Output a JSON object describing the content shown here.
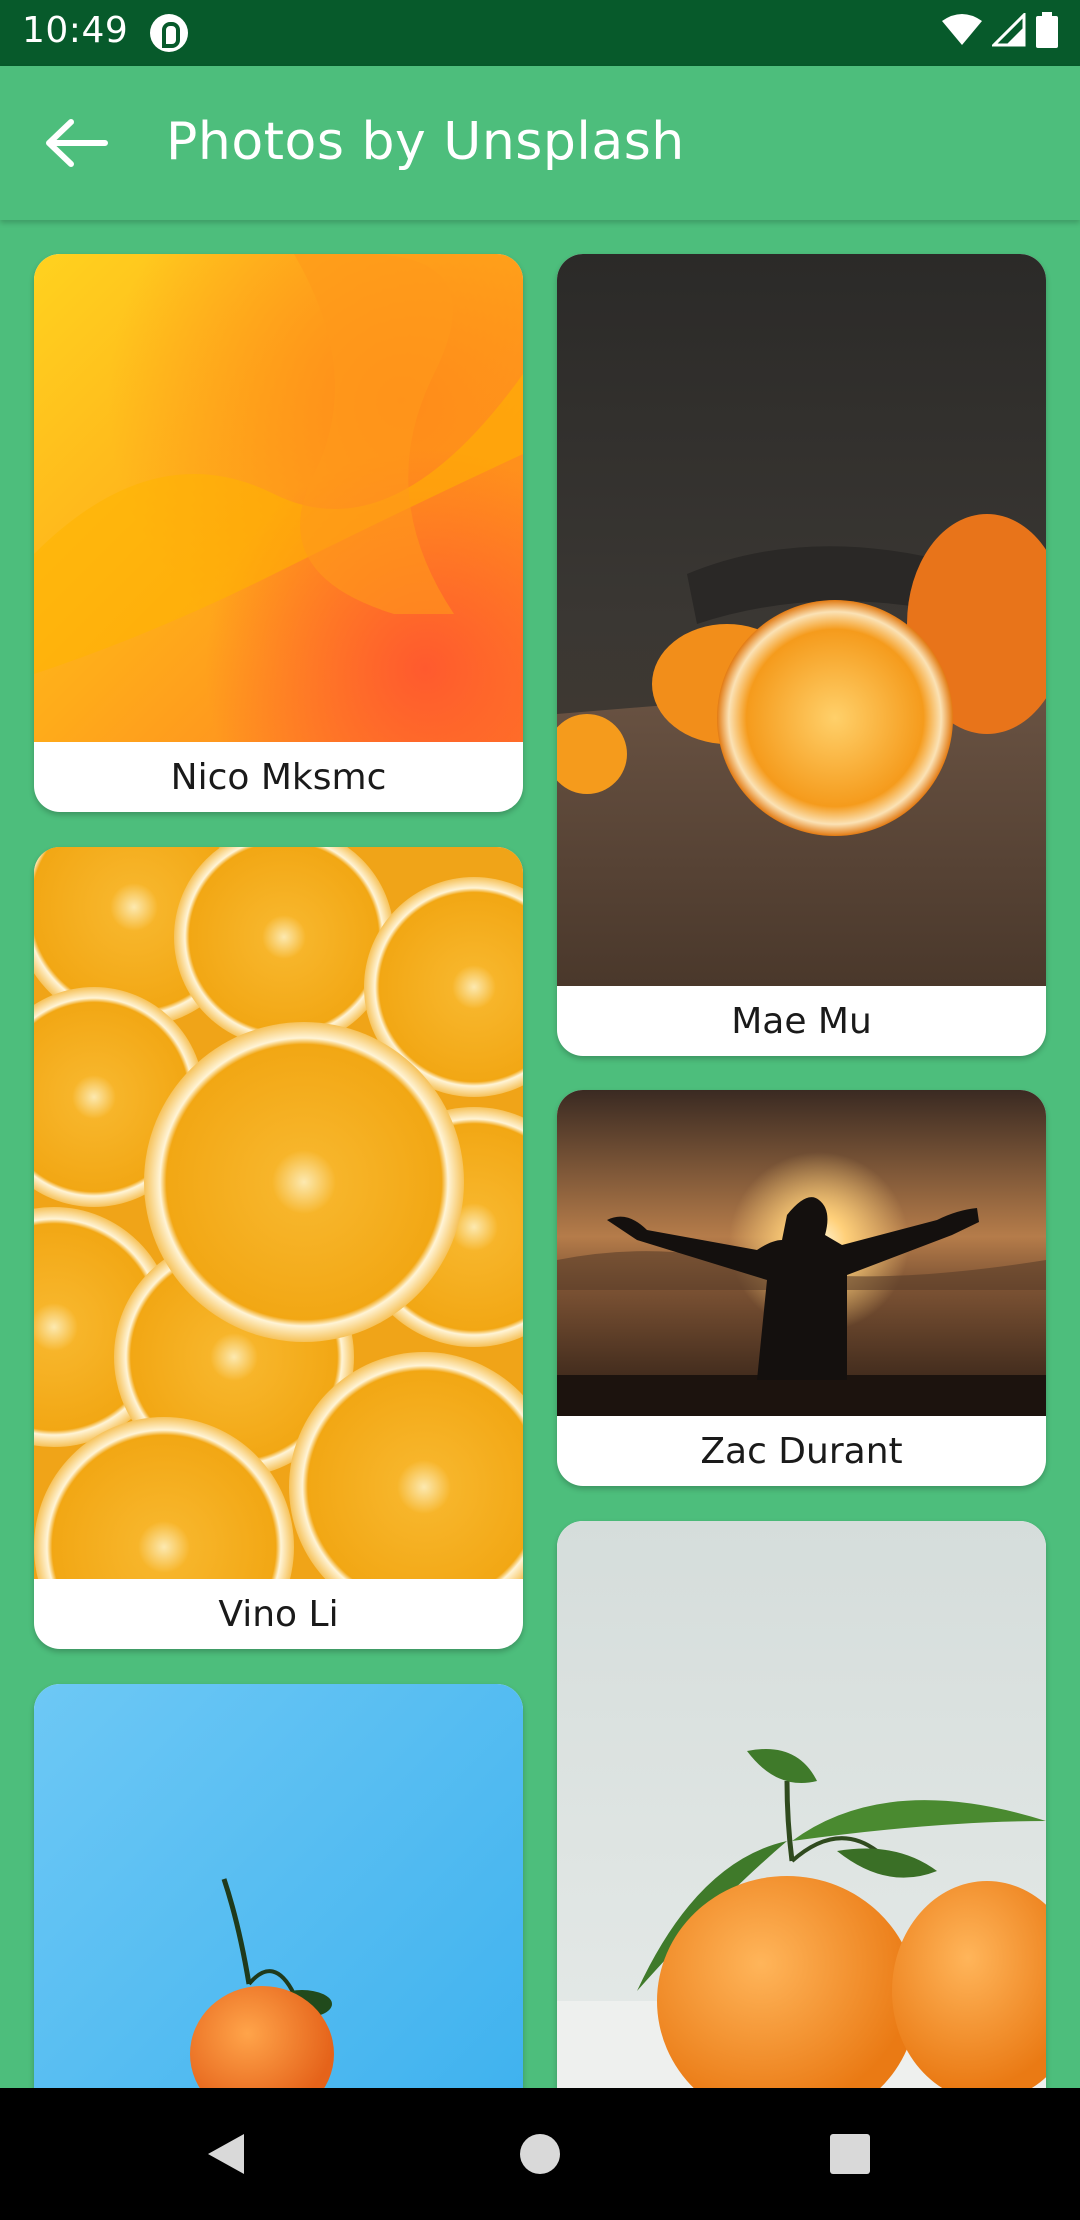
{
  "status_bar": {
    "time": "10:49",
    "icons": [
      "app-notification-icon",
      "wifi-icon",
      "signal-icon",
      "battery-icon"
    ]
  },
  "app_bar": {
    "back_icon": "arrow-left-icon",
    "title": "Photos by Unsplash"
  },
  "photos": [
    {
      "author": "Nico Mksmc",
      "subject": "orange and yellow abstract fluid"
    },
    {
      "author": "Mae Mu",
      "subject": "halved orange on wooden board"
    },
    {
      "author": "Vino Li",
      "subject": "orange slices pattern"
    },
    {
      "author": "Zac Durant",
      "subject": "person with open arms at sunset"
    },
    {
      "author": "",
      "subject": "tangerine on blue background"
    },
    {
      "author": "",
      "subject": "oranges with leaves on white"
    }
  ],
  "nav_bar": {
    "icons": [
      "back-triangle-icon",
      "home-circle-icon",
      "recents-square-icon"
    ]
  },
  "colors": {
    "primary": "#4dbe7c",
    "status_bar": "#075a2b",
    "card": "#ffffff"
  }
}
